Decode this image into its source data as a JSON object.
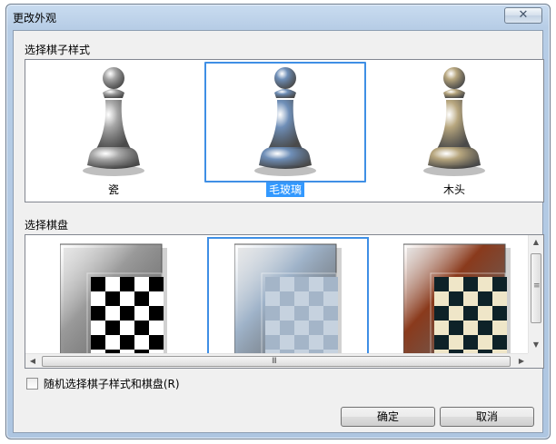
{
  "window": {
    "title": "更改外观",
    "close_glyph": "✕"
  },
  "pieces_section": {
    "label": "选择棋子样式",
    "items": [
      {
        "label": "瓷",
        "selected": false,
        "color": "#a8a8a8"
      },
      {
        "label": "毛玻璃",
        "selected": true,
        "color": "#6f8fb8"
      },
      {
        "label": "木头",
        "selected": false,
        "color": "#b8a77f"
      }
    ]
  },
  "boards_section": {
    "label": "选择棋盘",
    "items": [
      {
        "name": "stone-board",
        "selected": false,
        "frame_color": "#9a9a9a",
        "light": "#ffffff",
        "dark": "#000000"
      },
      {
        "name": "glass-board",
        "selected": true,
        "frame_color": "#9fb3c9",
        "light": "#c6d2df",
        "dark": "#a4b5c8"
      },
      {
        "name": "wood-board",
        "selected": false,
        "frame_color": "#8a3a1c",
        "light": "#efe6c8",
        "dark": "#0e2228"
      }
    ],
    "scroll_grip": "III",
    "vscroll_grip": "≡"
  },
  "random_option": {
    "label": "随机选择棋子样式和棋盘(R)",
    "checked": false
  },
  "buttons": {
    "ok": "确定",
    "cancel": "取消"
  },
  "colors": {
    "selection_border": "#3f8fe5",
    "selection_highlight": "#3399ff"
  }
}
